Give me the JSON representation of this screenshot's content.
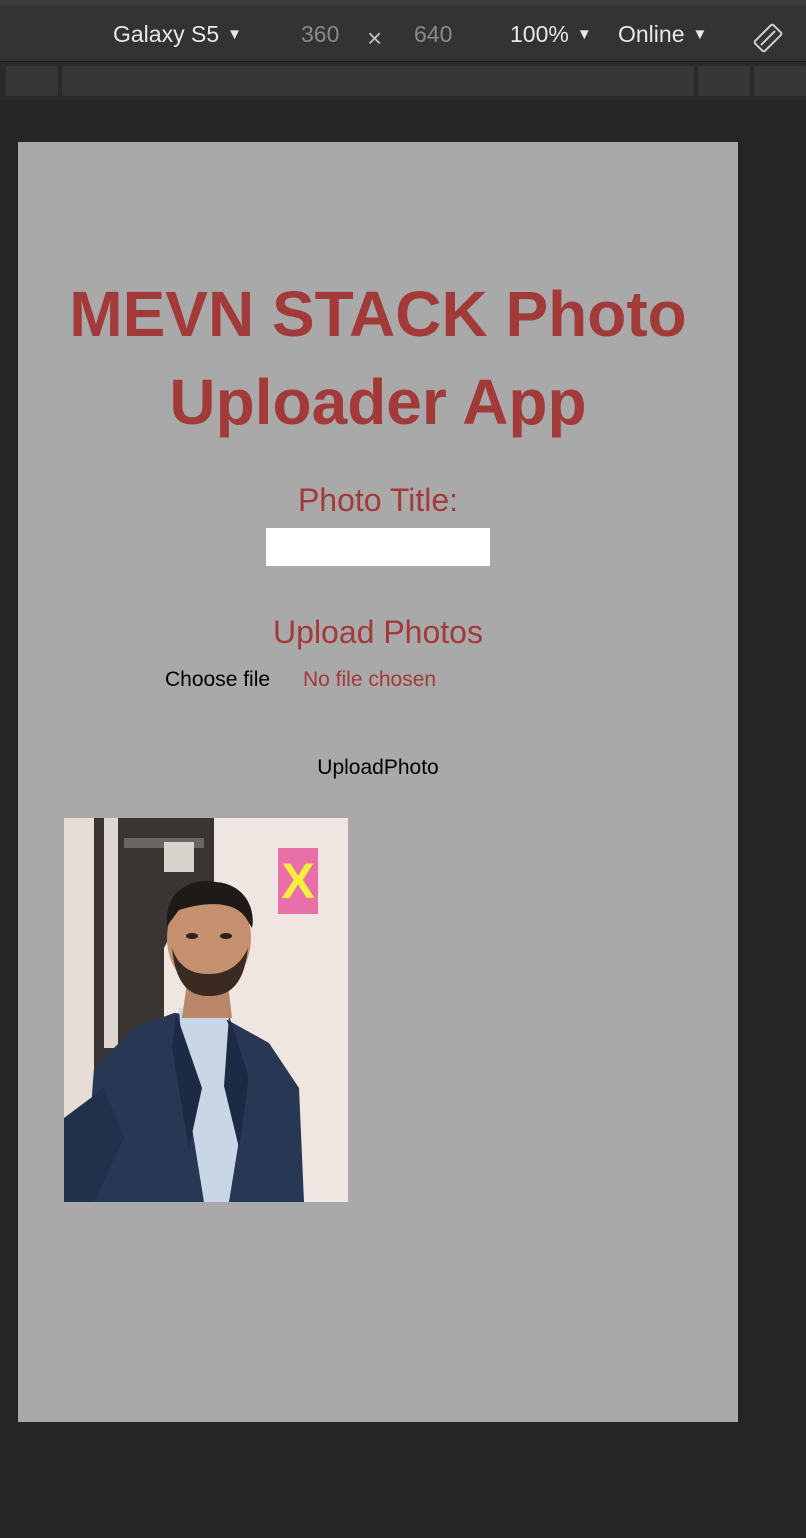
{
  "devtools": {
    "device": "Galaxy S5",
    "width": "360",
    "times": "×",
    "height": "640",
    "zoom": "100%",
    "network": "Online",
    "caret": "▼"
  },
  "app": {
    "title": "MEVN STACK Photo Uploader App",
    "photo_title_label": "Photo Title:",
    "photo_title_value": "",
    "upload_label": "Upload Photos",
    "choose_file": "Choose file",
    "no_file": "No file chosen",
    "upload_button": "UploadPhoto",
    "delete_label": "X"
  },
  "colors": {
    "accent": "#a33a3a",
    "viewport_bg": "#a9a9a9",
    "delete_bg": "#e86fa8",
    "delete_fg": "#f5f03c"
  }
}
